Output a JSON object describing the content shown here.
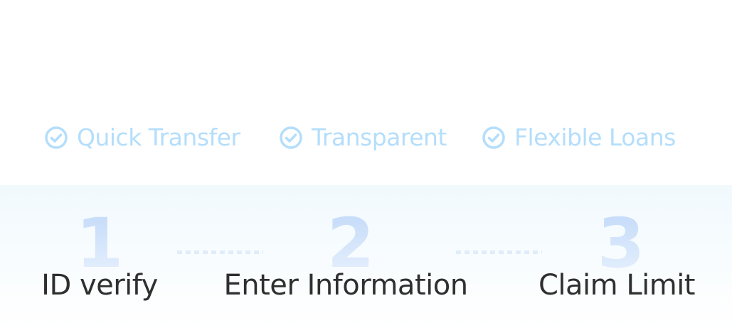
{
  "features": [
    {
      "label": "Quick Transfer",
      "icon": "check-circle-icon"
    },
    {
      "label": "Transparent",
      "icon": "check-circle-icon"
    },
    {
      "label": "Flexible Loans",
      "icon": "check-circle-icon"
    }
  ],
  "steps": [
    {
      "number": "1",
      "label": "ID verify"
    },
    {
      "number": "2",
      "label": "Enter Information"
    },
    {
      "number": "3",
      "label": "Claim Limit"
    }
  ],
  "colors": {
    "feature": "#b4defb",
    "number": "#c3daf9",
    "label": "#2f2f2f",
    "band": "#f1f9fd"
  }
}
